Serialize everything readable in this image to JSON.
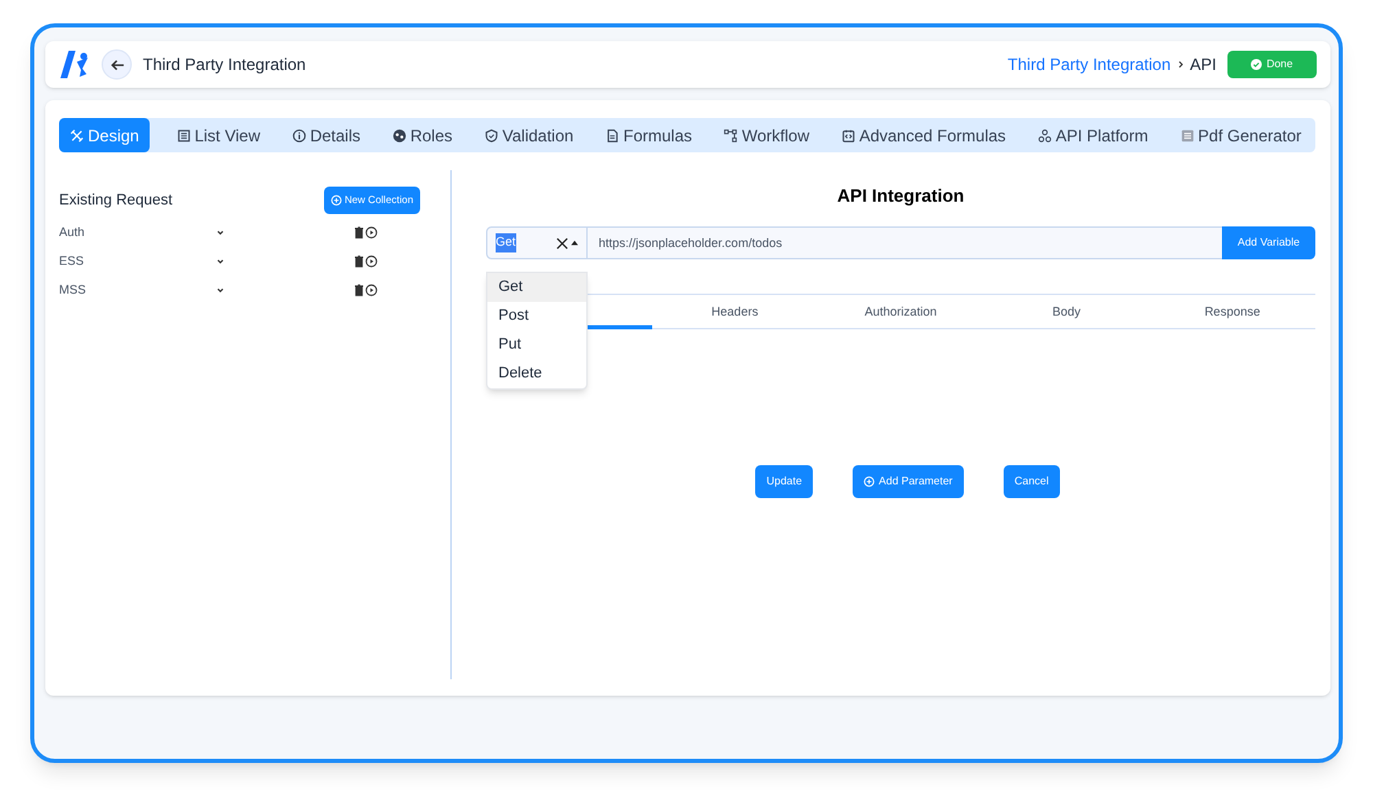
{
  "header": {
    "title": "Third Party Integration",
    "breadcrumb": [
      {
        "label": "Third Party Integration",
        "kind": "link"
      },
      {
        "label": "API",
        "kind": "current"
      }
    ],
    "done_button": "Done"
  },
  "tabs": [
    {
      "label": "Design",
      "selected": true
    },
    {
      "label": "List View",
      "selected": false
    },
    {
      "label": "Details",
      "selected": false
    },
    {
      "label": "Roles",
      "selected": false
    },
    {
      "label": "Validation",
      "selected": false
    },
    {
      "label": "Formulas",
      "selected": false
    },
    {
      "label": "Workflow",
      "selected": false
    },
    {
      "label": "Advanced Formulas",
      "selected": false
    },
    {
      "label": "API Platform",
      "selected": false
    },
    {
      "label": "Pdf Generator",
      "selected": false
    }
  ],
  "sidebar": {
    "title": "Existing Request",
    "new_button": "New Collection",
    "items": [
      {
        "label": "Auth"
      },
      {
        "label": "ESS"
      },
      {
        "label": "MSS"
      }
    ]
  },
  "api": {
    "title": "API Integration",
    "method": "Get",
    "url": "https://jsonplaceholder.com/todos",
    "add_variable": "Add Variable",
    "method_options": [
      {
        "label": "Get",
        "selected": true
      },
      {
        "label": "Post",
        "selected": false
      },
      {
        "label": "Put",
        "selected": false
      },
      {
        "label": "Delete",
        "selected": false
      }
    ],
    "subtabs": [
      {
        "selected": true
      },
      {
        "label": "Headers",
        "selected": false
      },
      {
        "label": "Authorization",
        "selected": false
      },
      {
        "label": "Body",
        "selected": false
      },
      {
        "label": "Response",
        "selected": false
      }
    ],
    "buttons": [
      {
        "label": "Update",
        "icon": false
      },
      {
        "label": "Add Parameter",
        "icon": true
      },
      {
        "label": "Cancel",
        "icon": false
      }
    ]
  }
}
